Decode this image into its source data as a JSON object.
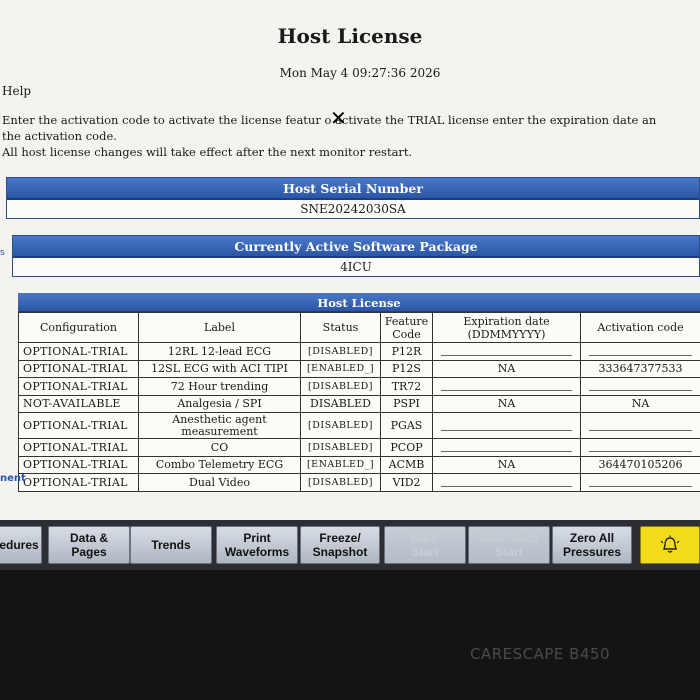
{
  "title": "Host License",
  "datetime": "Mon May 4 09:27:36 2026",
  "help_label": "Help",
  "instructions": {
    "line1": "Enter the activation code to activate the license featur  o activate the TRIAL license enter the expiration date an",
    "line2": "the activation code.",
    "line3": " All host license changes will take effect after the next monitor restart."
  },
  "serial_panel": {
    "header": "Host Serial Number",
    "value": "SNE20242030SA"
  },
  "package_panel": {
    "header": "Currently Active Software Package",
    "value": "4ICU"
  },
  "side_labels": {
    "s": "s",
    "nent": "nent"
  },
  "license_table": {
    "header": "Host License",
    "columns": [
      "Configuration",
      "Label",
      "Status",
      "Feature Code",
      "Expiration date (DDMMYYYY)",
      "Activation code"
    ],
    "rows": [
      [
        "OPTIONAL-TRIAL",
        "12RL 12-lead ECG",
        "[DISABLED]",
        "P12R",
        "",
        ""
      ],
      [
        "OPTIONAL-TRIAL",
        "12SL ECG with ACI TIPI",
        "[ENABLED_]",
        "P12S",
        "NA",
        "333647377533"
      ],
      [
        "OPTIONAL-TRIAL",
        "72 Hour trending",
        "[DISABLED]",
        "TR72",
        "",
        ""
      ],
      [
        "NOT-AVAILABLE",
        "Analgesia / SPI",
        "DISABLED",
        "PSPI",
        "NA",
        "NA"
      ],
      [
        "OPTIONAL-TRIAL",
        "Anesthetic agent measurement",
        "[DISABLED]",
        "PGAS",
        "",
        ""
      ],
      [
        "OPTIONAL-TRIAL",
        "CO",
        "[DISABLED]",
        "PCOP",
        "",
        ""
      ],
      [
        "OPTIONAL-TRIAL",
        "Combo Telemetry ECG",
        "[ENABLED_]",
        "ACMB",
        "NA",
        "364470105206"
      ],
      [
        "OPTIONAL-TRIAL",
        "Dual Video",
        "[DISABLED]",
        "VID2",
        "",
        ""
      ]
    ]
  },
  "toolbar": {
    "procedures": "edures",
    "data_pages": "Data &\nPages",
    "trends": "Trends",
    "print_waveforms": "Print\nWaveforms",
    "freeze_snapshot": "Freeze/\nSnapshot",
    "nibp_start": "NIBP\nStart",
    "nibp_auto_start": "NIBP Auto\nStart",
    "zero_all_pressures": "Zero All\nPressures",
    "alarm_icon": "alarm-bell-icon"
  },
  "bezel_brand": "CARESCAPE B450",
  "colors": {
    "header_blue": "#2b56a6",
    "alarm_yellow": "#f2dc1a",
    "screen_bg": "#f4f3ef"
  }
}
